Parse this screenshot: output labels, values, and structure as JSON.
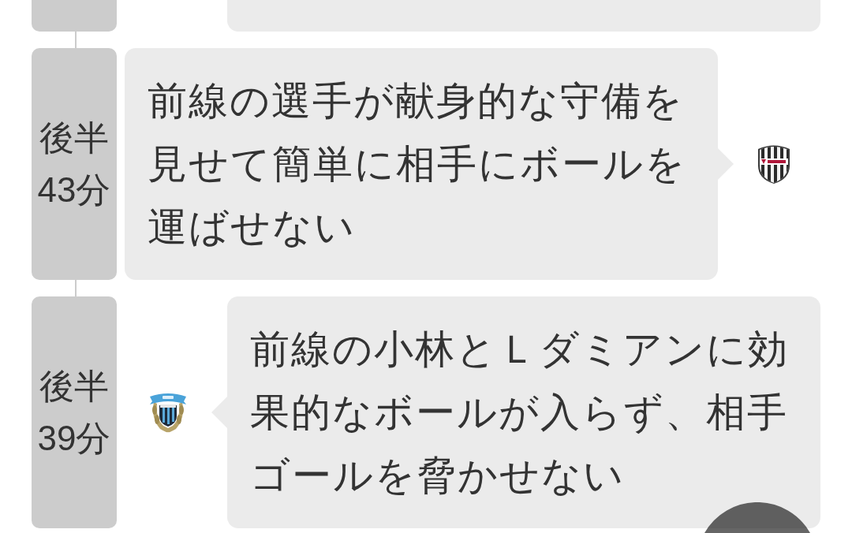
{
  "timeline": [
    {
      "kind": "away"
    },
    {
      "kind": "home",
      "period": "後半",
      "minute": "43分",
      "text": "前線の選手が献身的な守備を見せて簡単に相手にボールを運ばせない"
    },
    {
      "kind": "away",
      "period": "後半",
      "minute": "39分",
      "text": "前線の小林とＬダミアンに効果的なボールが入らず、相手ゴールを脅かせない"
    }
  ]
}
